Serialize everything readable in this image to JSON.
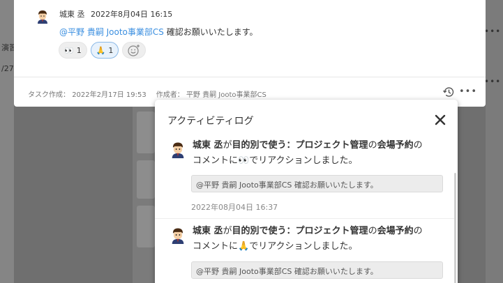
{
  "background": {
    "left_texts": [
      "演習",
      "/27"
    ],
    "dots": "•••"
  },
  "comment": {
    "author": "城東 丞",
    "timestamp": "2022年8月04日 16:15",
    "mention": "@平野 貴嗣 Jooto事業部CS",
    "body": "確認お願いいたします。",
    "reactions": [
      {
        "emoji": "👀",
        "count": "1",
        "active": false
      },
      {
        "emoji": "🙏",
        "count": "1",
        "active": true
      }
    ]
  },
  "footer": {
    "created_label": "タスク作成：",
    "created_date": "2022年2月17日 19:53",
    "creator_label": "作成者：",
    "creator": "平野 貴嗣 Jooto事業部CS"
  },
  "activity_log": {
    "title": "アクティビティログ",
    "entries": [
      {
        "user": "城東 丞",
        "particle1": "が",
        "project": "目的別で使う：プロジェクト管理",
        "particle2": "の",
        "task": "会場予約",
        "particle3": "の",
        "line2_prefix": "コメントに",
        "emoji": "👀",
        "line2_suffix": "でリアクションしました。",
        "quote": "@平野 貴嗣 Jooto事業部CS 確認お願いいたします。",
        "date": "2022年08月04日 16:37"
      },
      {
        "user": "城東 丞",
        "particle1": "が",
        "project": "目的別で使う：プロジェクト管理",
        "particle2": "の",
        "task": "会場予約",
        "particle3": "の",
        "line2_prefix": "コメントに",
        "emoji": "🙏",
        "line2_suffix": "でリアクションしました。",
        "quote": "@平野 貴嗣 Jooto事業部CS 確認お願いいたします。"
      }
    ]
  },
  "colors": {
    "mention": "#3b8fe0",
    "overlay": "#6f6f6f"
  }
}
